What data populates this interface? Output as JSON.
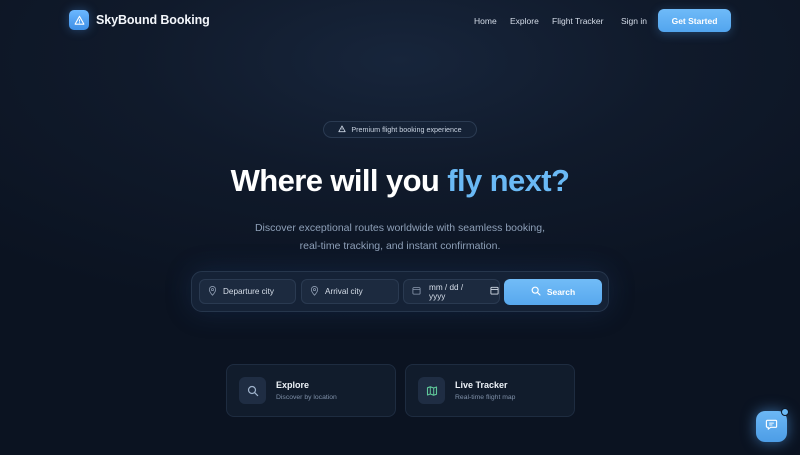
{
  "brand": {
    "name": "SkyBound Booking",
    "logo_icon": "warning-triangle-icon"
  },
  "nav": {
    "links": [
      "Home",
      "Explore",
      "Flight Tracker",
      "Sign in"
    ],
    "cta_label": "Get Started"
  },
  "hero": {
    "badge": "Premium flight booking experience",
    "headline_start": "Where will you ",
    "headline_accent": "fly next?",
    "subtitle": "Discover exceptional routes worldwide with seamless booking, real-time tracking, and instant confirmation."
  },
  "search": {
    "departure_placeholder": "Departure city",
    "arrival_placeholder": "Arrival city",
    "date_placeholder": "mm / dd / yyyy",
    "button_label": "Search"
  },
  "cards": [
    {
      "title": "Explore",
      "subtitle": "Discover by location",
      "icon": "search-icon"
    },
    {
      "title": "Live Tracker",
      "subtitle": "Real-time flight map",
      "icon": "map-icon"
    }
  ],
  "colors": {
    "background": "#0f1828",
    "accent": "#6ab9f5",
    "button": "#5aaaf0",
    "panel": "#152236"
  }
}
